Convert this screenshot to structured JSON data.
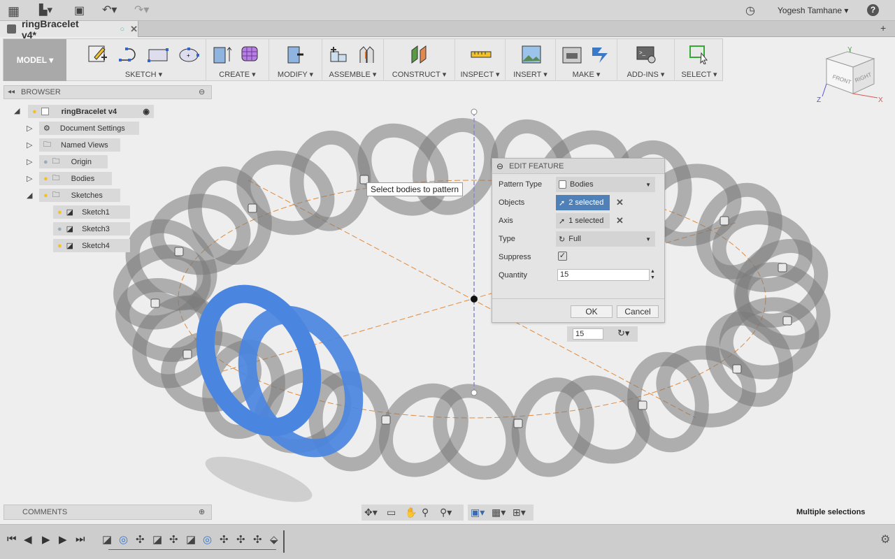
{
  "topbar": {
    "user": "Yogesh Tamhane",
    "icons": [
      "grid-icon",
      "file-icon",
      "save-icon",
      "undo-icon",
      "redo-icon",
      "clock-icon",
      "help-icon"
    ],
    "help": "?"
  },
  "tab": {
    "title": "ringBracelet v4*"
  },
  "toolbar": {
    "workspace": "MODEL ▾",
    "groups": [
      "SKETCH ▾",
      "CREATE ▾",
      "MODIFY ▾",
      "ASSEMBLE ▾",
      "CONSTRUCT ▾",
      "INSPECT ▾",
      "INSERT ▾",
      "MAKE ▾",
      "ADD-INS ▾",
      "SELECT ▾"
    ]
  },
  "browser": {
    "title": "BROWSER",
    "root": "ringBracelet v4",
    "items": [
      {
        "label": "Document Settings"
      },
      {
        "label": "Named Views"
      },
      {
        "label": "Origin"
      },
      {
        "label": "Bodies"
      },
      {
        "label": "Sketches"
      },
      {
        "label": "Sketch1"
      },
      {
        "label": "Sketch3"
      },
      {
        "label": "Sketch4"
      }
    ]
  },
  "comments": {
    "title": "COMMENTS"
  },
  "viewport": {
    "tooltip": "Select bodies to pattern",
    "quantity": "15",
    "body_color": "#4a86e0",
    "axis_color": "#8a8aca",
    "path_color": "#e08a3c"
  },
  "viewcube": {
    "front": "FRONT",
    "right": "RIGHT",
    "x": "X",
    "y": "Y",
    "z": "Z"
  },
  "dialog": {
    "title": "EDIT FEATURE",
    "pattern_type_label": "Pattern Type",
    "pattern_type": "Bodies",
    "objects_label": "Objects",
    "objects": "2 selected",
    "axis_label": "Axis",
    "axis": "1 selected",
    "type_label": "Type",
    "type": "Full",
    "suppress_label": "Suppress",
    "suppress": true,
    "quantity_label": "Quantity",
    "quantity": "15",
    "ok": "OK",
    "cancel": "Cancel",
    "accent": "#4f81b8"
  },
  "status": "Multiple selections"
}
